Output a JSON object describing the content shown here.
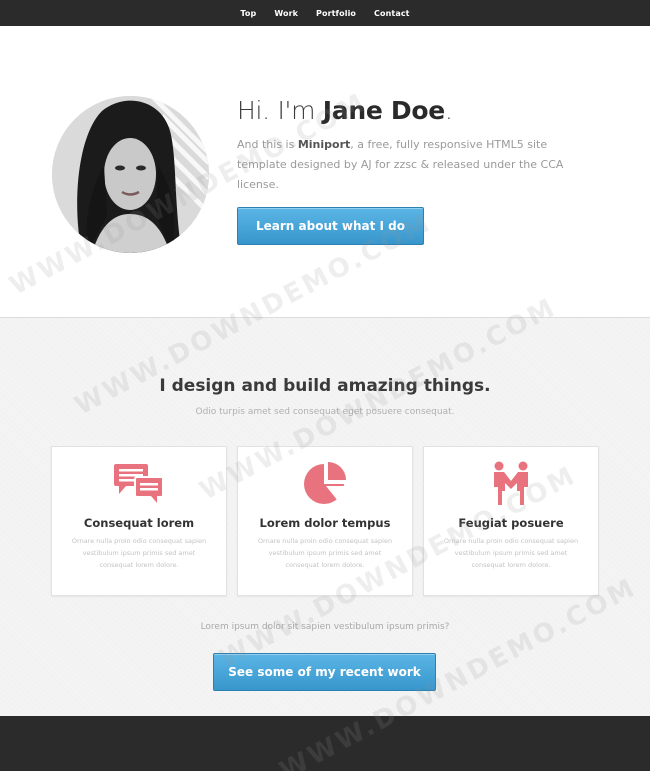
{
  "nav": {
    "items": [
      {
        "label": "Top"
      },
      {
        "label": "Work"
      },
      {
        "label": "Portfolio"
      },
      {
        "label": "Contact"
      }
    ]
  },
  "intro": {
    "greeting_prefix": "Hi. I'm ",
    "name": "Jane Doe",
    "greeting_suffix": ".",
    "lead_1": "And this is ",
    "product": "Miniport",
    "lead_2": ", a free, fully responsive HTML5 site template designed by AJ for zzsc & released under the CCA license.",
    "button": "Learn about what I do"
  },
  "work": {
    "title": "I design and build amazing things.",
    "subtitle": "Odio turpis amet sed consequat eget posuere consequat.",
    "boxes": [
      {
        "icon": "speech-bubbles-icon",
        "title": "Consequat lorem",
        "text": "Ornare nulla proin odio consequat sapien vestibulum ipsum primis sed amet consequat lorem dolore."
      },
      {
        "icon": "pie-chart-icon",
        "title": "Lorem dolor tempus",
        "text": "Ornare nulla proin odio consequat sapien vestibulum ipsum primis sed amet consequat lorem dolore."
      },
      {
        "icon": "handshake-people-icon",
        "title": "Feugiat posuere",
        "text": "Ornare nulla proin odio consequat sapien vestibulum ipsum primis sed amet consequat lorem dolore."
      }
    ],
    "footer_text": "Lorem ipsum dolor sit sapien vestibulum ipsum primis?",
    "button": "See some of my recent work"
  },
  "watermark": "WWW.DOWNDEMO.COM",
  "colors": {
    "accent": "#3a9ad1",
    "icon": "#e8737e",
    "nav_bg": "#2b2b2b"
  }
}
